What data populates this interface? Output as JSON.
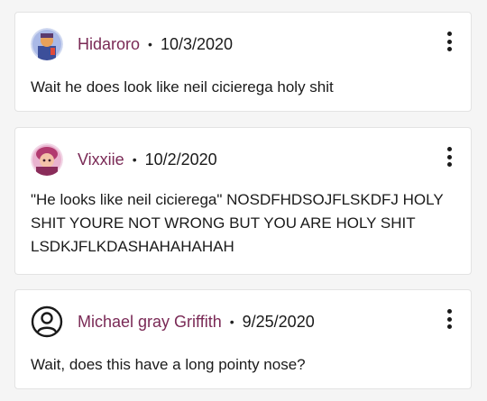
{
  "comments": [
    {
      "author": "Hidaroro",
      "separator": "•",
      "date": "10/3/2020",
      "text": "Wait he does look like neil cicierega holy shit",
      "avatar_icon": "avatar-photo-blue-character",
      "menu_icon": "more-vertical-icon"
    },
    {
      "author": "Vixxiie",
      "separator": "•",
      "date": "10/2/2020",
      "text": "\"He looks like neil cicierega\" NOSDFHDSOJFLSKDFJ HOLY SHIT YOURE NOT WRONG BUT YOU ARE HOLY SHIT LSDKJFLKDASHAHAHAHAH",
      "avatar_icon": "avatar-photo-pink-character",
      "menu_icon": "more-vertical-icon"
    },
    {
      "author": "Michael gray Griffith",
      "separator": "•",
      "date": "9/25/2020",
      "text": "Wait, does this have a long pointy nose?",
      "avatar_icon": "default-user-icon",
      "menu_icon": "more-vertical-icon"
    }
  ],
  "colors": {
    "author": "#7a2a56",
    "card_background": "#ffffff",
    "page_background": "#f5f5f5",
    "border": "#e3e3e3"
  }
}
